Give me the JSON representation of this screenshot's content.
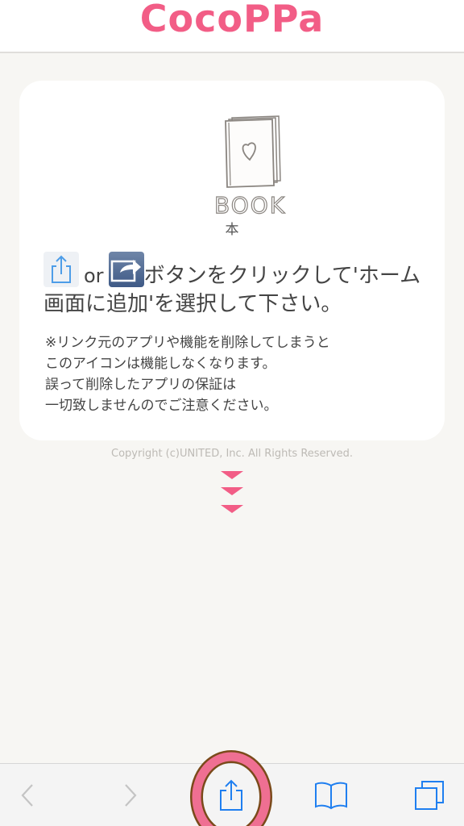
{
  "header": {
    "logo_text": "CocoPPa"
  },
  "card": {
    "book_label": "本",
    "instruction": {
      "or_text": "or",
      "text_after_icons": "ボタンをクリックして'ホーム画面に追加'を選択して下さい。"
    },
    "notice_lines": [
      "※リンク元のアプリや機能を削除してしまうと",
      "このアイコンは機能しなくなります。",
      "誤って削除したアプリの保証は",
      "一切致しませんのでご注意ください。"
    ]
  },
  "footer": {
    "copyright": "Copyright (c)UNITED, Inc. All Rights Reserved."
  },
  "toolbar": {
    "items": [
      {
        "icon": "back-chevron-icon",
        "enabled": false
      },
      {
        "icon": "forward-chevron-icon",
        "enabled": false
      },
      {
        "icon": "share-icon",
        "enabled": true,
        "highlighted": true
      },
      {
        "icon": "bookmarks-icon",
        "enabled": true
      },
      {
        "icon": "tabs-icon",
        "enabled": true
      }
    ]
  },
  "colors": {
    "brand_pink": "#f25d86",
    "ios_blue": "#1f7ff0",
    "disabled_gray": "#c4c4c4",
    "background": "#f7f6f3",
    "card_bg": "#ffffff",
    "highlight_ring": "#ef6f92"
  }
}
